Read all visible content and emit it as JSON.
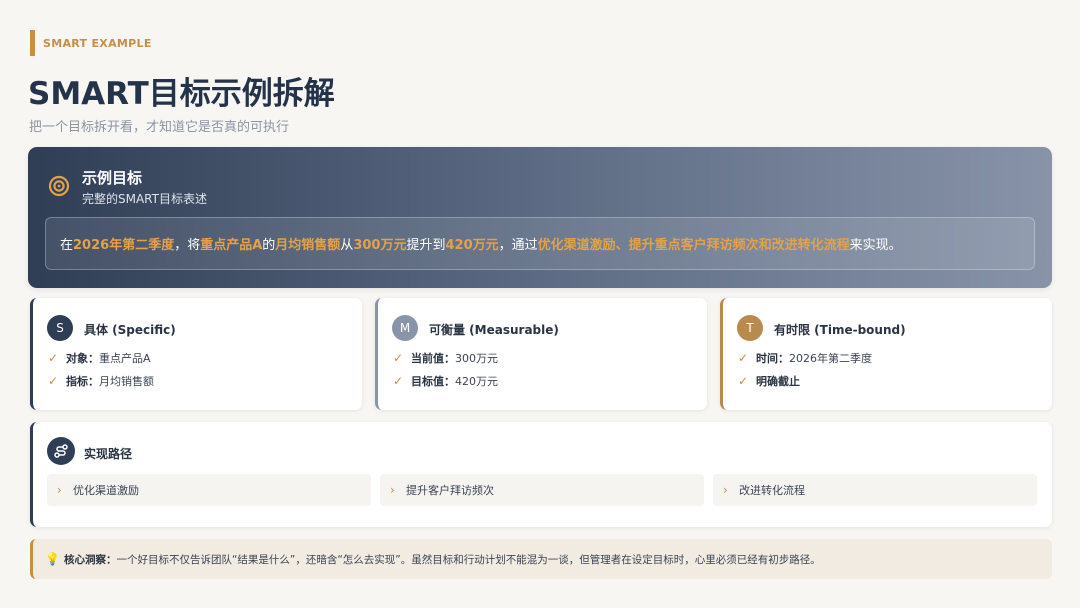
{
  "header": {
    "eyebrow": "SMART EXAMPLE",
    "title": "SMART目标示例拆解",
    "subtitle": "把一个目标拆开看，才知道它是否真的可执行"
  },
  "example": {
    "title": "示例目标",
    "subtitle": "完整的SMART目标表述",
    "icon": "target-icon",
    "sentence": {
      "p1": "在",
      "h1": "2026年第二季度",
      "p2": "，将",
      "h2": "重点产品A",
      "p3": "的",
      "h3": "月均销售额",
      "p4": "从",
      "h4": "300万元",
      "p5": "提升到",
      "h5": "420万元",
      "p6": "，通过",
      "h6": "优化渠道激励、提升重点客户拜访频次和改进转化流程",
      "p7": "来实现。"
    }
  },
  "cards": [
    {
      "badge": "S",
      "title": "具体 (Specific)",
      "color": "#2f3d55",
      "rows": [
        {
          "key": "对象：",
          "value": "重点产品A"
        },
        {
          "key": "指标：",
          "value": "月均销售额"
        }
      ]
    },
    {
      "badge": "M",
      "title": "可衡量 (Measurable)",
      "color": "#8a94a8",
      "rows": [
        {
          "key": "当前值：",
          "value": "300万元"
        },
        {
          "key": "目标值：",
          "value": "420万元"
        }
      ]
    },
    {
      "badge": "T",
      "title": "有时限 (Time-bound)",
      "color": "#b98a4d",
      "rows": [
        {
          "key": "时间：",
          "value": "2026年第二季度"
        },
        {
          "key": "明确截止",
          "value": ""
        }
      ]
    }
  ],
  "path": {
    "title": "实现路径",
    "icon": "route-icon",
    "steps": [
      "优化渠道激励",
      "提升客户拜访频次",
      "改进转化流程"
    ]
  },
  "insight": {
    "icon": "lightbulb-icon",
    "key": "核心洞察：",
    "text": "一个好目标不仅告诉团队“结果是什么”，还暗含“怎么去实现”。虽然目标和行动计划不能混为一谈，但管理者在设定目标时，心里必须已经有初步路径。"
  },
  "colors": {
    "accent": "#c58f45",
    "navy": "#2f3d55",
    "background": "#f7f6f3"
  }
}
